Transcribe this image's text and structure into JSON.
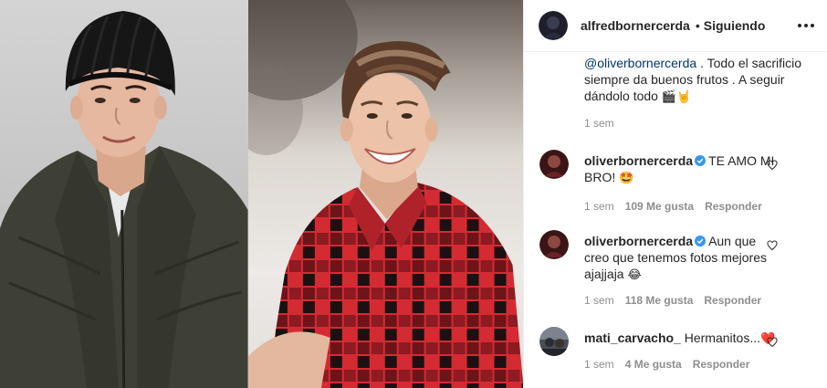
{
  "header": {
    "username": "alfredbornercerda",
    "separator": "•",
    "follow_status": "Siguiendo",
    "more_icon": "more-horizontal-icon"
  },
  "caption": {
    "mention": "@oliverbornercerda",
    "text": " . Todo el sacrificio siempre da buenos frutos . A seguir dándolo todo ",
    "emoji": "🎬🤘",
    "time": "1 sem"
  },
  "comments": [
    {
      "username": "oliverbornercerda",
      "verified": true,
      "text": "TE AMO MI BRO! ",
      "emoji": "🤩",
      "time": "1 sem",
      "likes": "109 Me gusta",
      "reply": "Responder"
    },
    {
      "username": "oliverbornercerda",
      "verified": true,
      "text": "Aun que creo que tenemos fotos mejores ajajjaja ",
      "emoji": "😂",
      "time": "1 sem",
      "likes": "118 Me gusta",
      "reply": "Responder"
    },
    {
      "username": "mati_carvacho_",
      "verified": false,
      "text": "Hermanitos...",
      "emoji": "❤️",
      "time": "1 sem",
      "likes": "4 Me gusta",
      "reply": "Responder"
    }
  ],
  "colors": {
    "text": "#262626",
    "secondary": "#8e8e8e",
    "link": "#00376b",
    "verified": "#3897f0",
    "heart": "#ed4956",
    "divider": "#efefef"
  }
}
